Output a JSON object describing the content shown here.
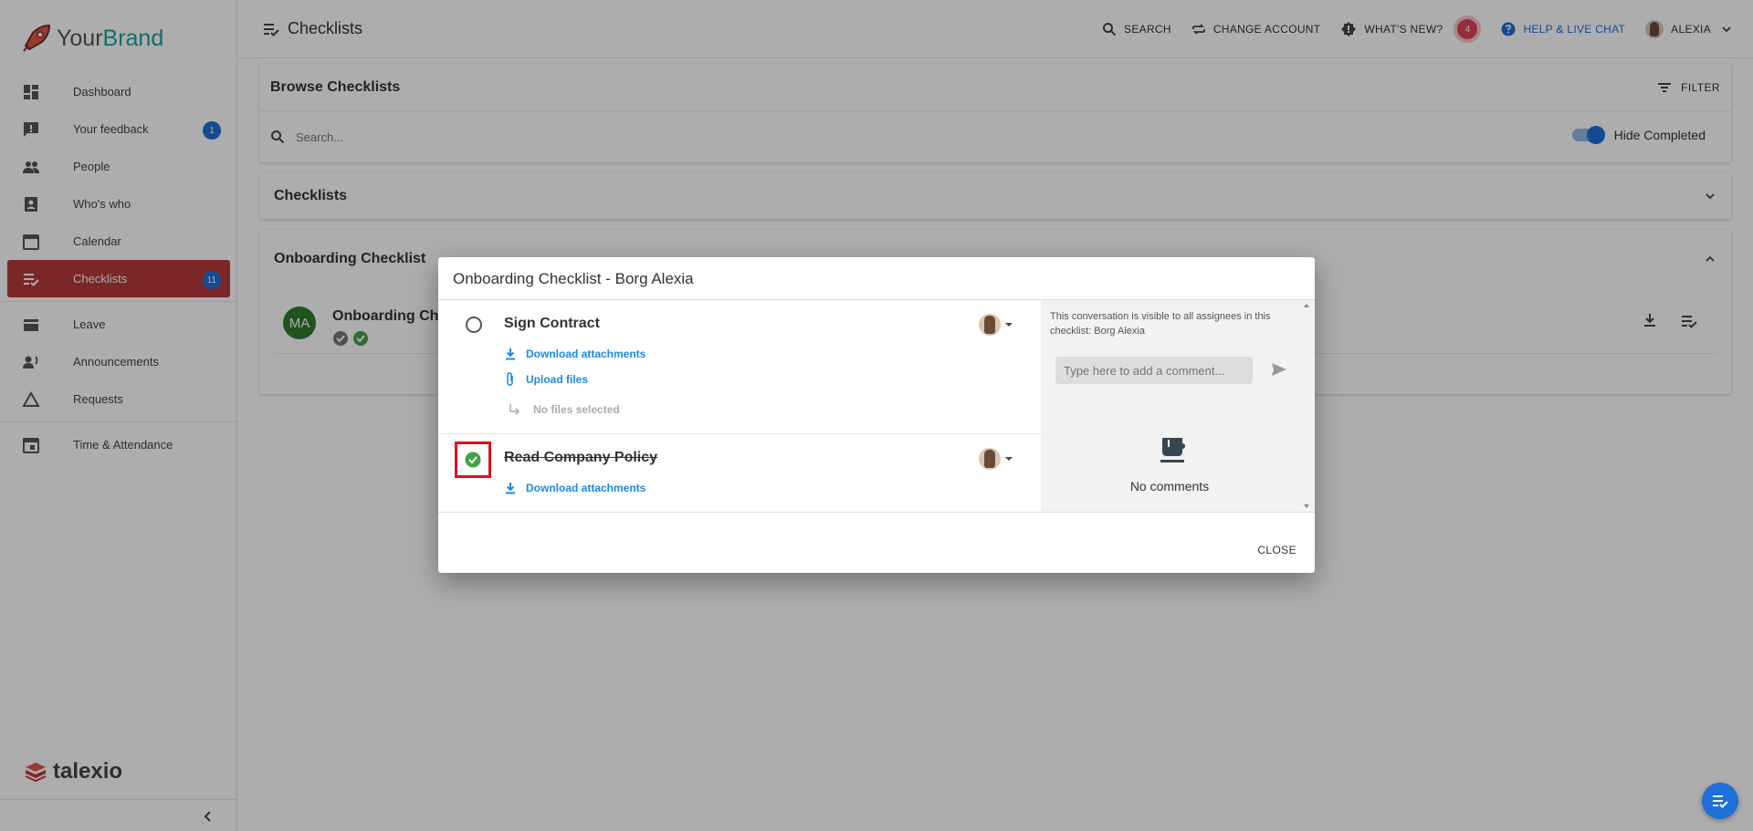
{
  "sidebar": {
    "brand_part1": "Your",
    "brand_part2": "Brand",
    "items": [
      {
        "label": "Dashboard",
        "icon": "dashboard-icon"
      },
      {
        "label": "Your feedback",
        "icon": "feedback-icon",
        "badge": "1"
      },
      {
        "label": "People",
        "icon": "people-icon"
      },
      {
        "label": "Who's who",
        "icon": "contact-icon"
      },
      {
        "label": "Calendar",
        "icon": "calendar-icon"
      },
      {
        "label": "Checklists",
        "icon": "checklist-icon",
        "badge": "11",
        "active": true
      },
      {
        "label": "Leave",
        "icon": "leave-icon"
      },
      {
        "label": "Announcements",
        "icon": "announcements-icon"
      },
      {
        "label": "Requests",
        "icon": "requests-icon"
      },
      {
        "label": "Time & Attendance",
        "icon": "time-icon"
      }
    ],
    "footer_logo": "talexio"
  },
  "header": {
    "title": "Checklists",
    "search": "SEARCH",
    "change_account": "CHANGE ACCOUNT",
    "whats_new": "WHAT'S NEW?",
    "notif_count": "4",
    "help": "HELP & LIVE CHAT",
    "user": "ALEXIA"
  },
  "browse": {
    "title": "Browse Checklists",
    "filter": "FILTER",
    "search_placeholder": "Search...",
    "hide_completed": "Hide Completed"
  },
  "checklists_section": {
    "title": "Checklists"
  },
  "onboarding": {
    "title": "Onboarding Checklist",
    "avatar_initials": "MA",
    "row_name": "Onboarding Ch"
  },
  "modal": {
    "title": "Onboarding Checklist - Borg Alexia",
    "tasks": [
      {
        "name": "Sign Contract",
        "download": "Download attachments",
        "upload": "Upload files",
        "no_files": "No files selected",
        "completed": false
      },
      {
        "name": "Read Company Policy",
        "download": "Download attachments",
        "completed": true
      }
    ],
    "conversation_note": "This conversation is visible to all assignees in this checklist: Borg Alexia",
    "comment_placeholder": "Type here to add a comment...",
    "no_comments": "No comments",
    "close": "CLOSE"
  },
  "colors": {
    "accent": "#1e6fd9",
    "active_nav": "#b73a3a",
    "success": "#43a047",
    "highlight": "#e0101a"
  }
}
